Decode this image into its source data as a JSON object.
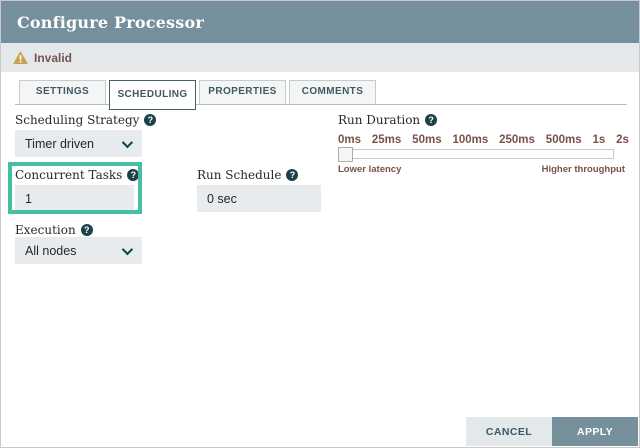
{
  "dialog": {
    "title": "Configure Processor",
    "status": {
      "label": "Invalid",
      "icon": "warning-triangle"
    }
  },
  "tabs": [
    {
      "label": "SETTINGS",
      "active": false
    },
    {
      "label": "SCHEDULING",
      "active": true
    },
    {
      "label": "PROPERTIES",
      "active": false
    },
    {
      "label": "COMMENTS",
      "active": false
    }
  ],
  "fields": {
    "scheduling_strategy": {
      "label": "Scheduling Strategy",
      "value": "Timer driven",
      "control": "dropdown"
    },
    "concurrent_tasks": {
      "label": "Concurrent Tasks",
      "value": "1",
      "control": "text",
      "highlighted": true
    },
    "run_schedule": {
      "label": "Run Schedule",
      "value": "0 sec",
      "control": "text"
    },
    "execution": {
      "label": "Execution",
      "value": "All nodes",
      "control": "dropdown"
    },
    "run_duration": {
      "label": "Run Duration",
      "control": "slider",
      "ticks": [
        "0ms",
        "25ms",
        "50ms",
        "100ms",
        "250ms",
        "500ms",
        "1s",
        "2s"
      ],
      "selected": "0ms",
      "left_caption": "Lower latency",
      "right_caption": "Higher throughput"
    }
  },
  "buttons": {
    "cancel": "CANCEL",
    "apply": "APPLY"
  },
  "colors": {
    "header_bg": "#75909c",
    "status_bar_bg": "#e5e8ea",
    "warning_icon": "#c7a24e",
    "status_text": "#775351",
    "input_bg": "#e8ebed",
    "highlight_accent": "#45bfa2",
    "slider_text": "#7a5148",
    "tab_text": "#3f5863",
    "apply_bg": "#76909c",
    "cancel_bg": "#e3e8ea"
  }
}
